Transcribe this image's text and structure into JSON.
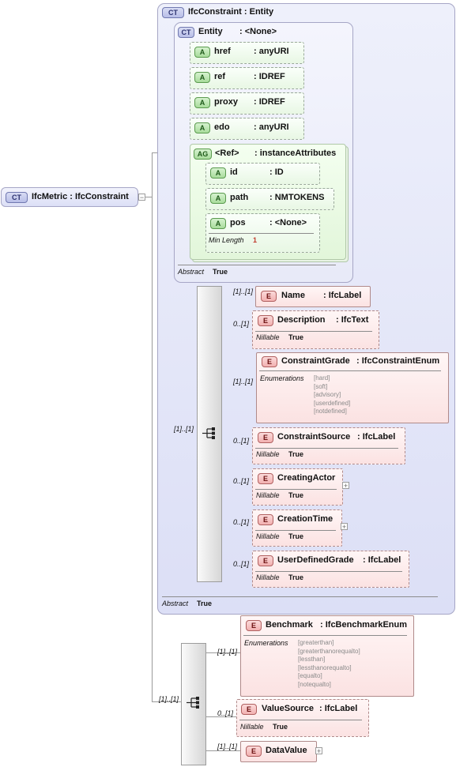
{
  "root": {
    "badge": "CT",
    "label": "IfcMetric : IfcConstraint"
  },
  "constraint": {
    "badge": "CT",
    "label": "IfcConstraint : Entity",
    "abstract_label": "Abstract",
    "abstract_value": "True",
    "entity": {
      "badge": "CT",
      "name": "Entity",
      "type": ": <None>",
      "abstract_label": "Abstract",
      "abstract_value": "True",
      "attributes": [
        {
          "badge": "A",
          "name": "href",
          "type": ": anyURI"
        },
        {
          "badge": "A",
          "name": "ref",
          "type": ": IDREF"
        },
        {
          "badge": "A",
          "name": "proxy",
          "type": ": IDREF"
        },
        {
          "badge": "A",
          "name": "edo",
          "type": ": anyURI"
        }
      ],
      "attribute_group": {
        "badge": "AG",
        "name": "<Ref>",
        "type": ": instanceAttributes",
        "attributes": [
          {
            "badge": "A",
            "name": "id",
            "type": ": ID"
          },
          {
            "badge": "A",
            "name": "path",
            "type": ": NMTOKENS"
          },
          {
            "badge": "A",
            "name": "pos",
            "type": ": <None>",
            "facet_label": "Min Length",
            "facet_value": "1"
          }
        ]
      }
    },
    "sequence_cardinality": "[1]..[1]",
    "elements": [
      {
        "badge": "E",
        "name": "Name",
        "type": ": IfcLabel",
        "cardinality": "[1]..[1]"
      },
      {
        "badge": "E",
        "name": "Description",
        "type": ": IfcText",
        "cardinality": "0..[1]",
        "prop_label": "Nillable",
        "prop_value": "True"
      },
      {
        "badge": "E",
        "name": "ConstraintGrade",
        "type": ": IfcConstraintEnum",
        "cardinality": "[1]..[1]",
        "enum_label": "Enumerations",
        "enumerations": [
          "[hard]",
          "[soft]",
          "[advisory]",
          "[userdefined]",
          "[notdefined]"
        ]
      },
      {
        "badge": "E",
        "name": "ConstraintSource",
        "type": ": IfcLabel",
        "cardinality": "0..[1]",
        "prop_label": "Nillable",
        "prop_value": "True"
      },
      {
        "badge": "E",
        "name": "CreatingActor",
        "type": "",
        "cardinality": "0..[1]",
        "prop_label": "Nillable",
        "prop_value": "True",
        "expandable": "+"
      },
      {
        "badge": "E",
        "name": "CreationTime",
        "type": "",
        "cardinality": "0..[1]",
        "prop_label": "Nillable",
        "prop_value": "True",
        "expandable": "+"
      },
      {
        "badge": "E",
        "name": "UserDefinedGrade",
        "type": ": IfcLabel",
        "cardinality": "0..[1]",
        "prop_label": "Nillable",
        "prop_value": "True"
      }
    ]
  },
  "metric_sequence": {
    "cardinality": "[1]..[1]",
    "elements": [
      {
        "badge": "E",
        "name": "Benchmark",
        "type": ": IfcBenchmarkEnum",
        "cardinality": "[1]..[1]",
        "enum_label": "Enumerations",
        "enumerations": [
          "[greaterthan]",
          "[greaterthanorequalto]",
          "[lessthan]",
          "[lessthanorequalto]",
          "[equalto]",
          "[notequalto]"
        ]
      },
      {
        "badge": "E",
        "name": "ValueSource",
        "type": ": IfcLabel",
        "cardinality": "0..[1]",
        "prop_label": "Nillable",
        "prop_value": "True"
      },
      {
        "badge": "E",
        "name": "DataValue",
        "type": "",
        "cardinality": "[1]..[1]",
        "expandable": "+"
      }
    ]
  }
}
